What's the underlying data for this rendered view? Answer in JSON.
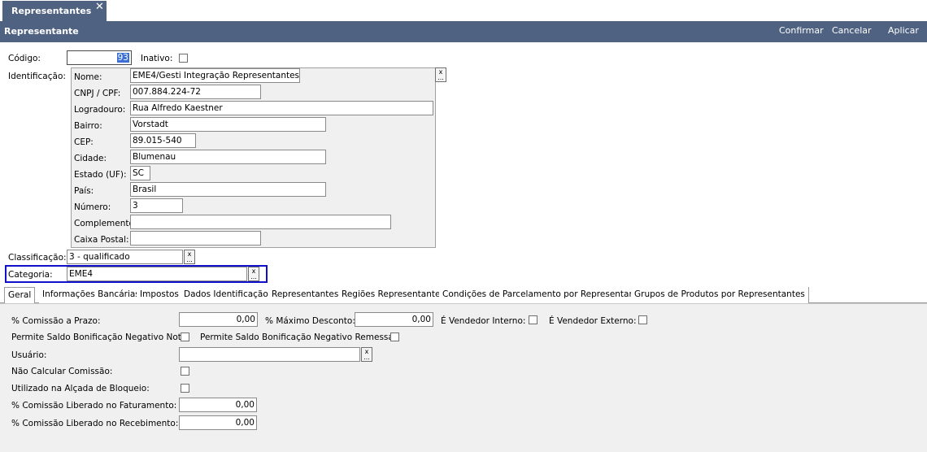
{
  "window_tab": {
    "title": "Representantes",
    "close_glyph": "✕"
  },
  "header": {
    "title": "Representante",
    "buttons": {
      "confirm": "Confirmar",
      "cancel": "Cancelar",
      "apply": "Aplicar"
    }
  },
  "form": {
    "codigo_label": "Código:",
    "codigo_value": "93",
    "inativo_label": "Inativo:",
    "identificacao_label": "Identificação:",
    "identificacao": {
      "nome_label": "Nome:",
      "nome_value": "EME4/Gesti Integração Representantes",
      "cnpj_label": "CNPJ / CPF:",
      "cnpj_value": "007.884.224-72",
      "logradouro_label": "Logradouro:",
      "logradouro_value": "Rua Alfredo Kaestner",
      "bairro_label": "Bairro:",
      "bairro_value": "Vorstadt",
      "cep_label": "CEP:",
      "cep_value": "89.015-540",
      "cidade_label": "Cidade:",
      "cidade_value": "Blumenau",
      "estado_label": "Estado (UF):",
      "estado_value": "SC",
      "pais_label": "País:",
      "pais_value": "Brasil",
      "numero_label": "Número:",
      "numero_value": "3",
      "complemento_label": "Complemento:",
      "complemento_value": "",
      "caixa_postal_label": "Caixa Postal:",
      "caixa_postal_value": ""
    },
    "classificacao_label": "Classificação:",
    "classificacao_value": "3 - qualificado",
    "categoria_label": "Categoria:",
    "categoria_value": "EME4"
  },
  "tabs": [
    "Geral",
    "Informações Bancárias",
    "Impostos",
    "Dados Identificação",
    "Representantes",
    "Regiões Representante",
    "Condições de Parcelamento por Representante",
    "Grupos de Produtos por Representantes"
  ],
  "geral": {
    "comissao_prazo_label": "% Comissão a Prazo:",
    "comissao_prazo_value": "0,00",
    "max_desconto_label": "% Máximo Desconto:",
    "max_desconto_value": "0,00",
    "vendedor_interno_label": "É Vendedor Interno:",
    "vendedor_externo_label": "É Vendedor Externo:",
    "saldo_bonif_nota_label": "Permite Saldo Bonificação Negativo Nota:",
    "saldo_bonif_remessa_label": "Permite Saldo Bonificação Negativo Remessa:",
    "usuario_label": "Usuário:",
    "usuario_value": "",
    "nao_calcular_label": "Não Calcular Comissão:",
    "alcada_label": "Utilizado na Alçada de Bloqueio:",
    "liberado_fat_label": "% Comissão Liberado no Faturamento:",
    "liberado_fat_value": "0,00",
    "liberado_rec_label": "% Comissão Liberado no Recebimento:",
    "liberado_rec_value": "0,00"
  },
  "picker_glyphs": {
    "clear": "x",
    "more": "..."
  },
  "colors": {
    "header_bg": "#4f6282",
    "highlight_border": "#1010c8"
  }
}
